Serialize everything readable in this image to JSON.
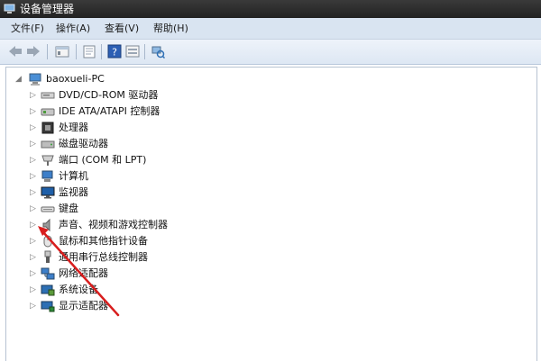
{
  "window": {
    "title": "设备管理器"
  },
  "menubar": {
    "items": [
      {
        "label": "文件(F)"
      },
      {
        "label": "操作(A)"
      },
      {
        "label": "查看(V)"
      },
      {
        "label": "帮助(H)"
      }
    ]
  },
  "toolbar": {
    "buttons": [
      {
        "icon": "back-arrow-icon"
      },
      {
        "icon": "forward-arrow-icon"
      },
      {
        "icon": "console-tree-icon"
      },
      {
        "icon": "properties-icon"
      },
      {
        "icon": "help-icon"
      },
      {
        "icon": "view-icon"
      },
      {
        "icon": "scan-hardware-icon"
      }
    ]
  },
  "tree": {
    "root": {
      "label": "baoxueli-PC",
      "icon": "computer-icon",
      "expanded": true
    },
    "items": [
      {
        "label": "DVD/CD-ROM 驱动器",
        "icon": "dvd-drive-icon"
      },
      {
        "label": "IDE ATA/ATAPI 控制器",
        "icon": "ide-controller-icon"
      },
      {
        "label": "处理器",
        "icon": "processor-icon"
      },
      {
        "label": "磁盘驱动器",
        "icon": "disk-drive-icon"
      },
      {
        "label": "端口 (COM 和 LPT)",
        "icon": "port-icon"
      },
      {
        "label": "计算机",
        "icon": "computer-icon"
      },
      {
        "label": "监视器",
        "icon": "monitor-icon"
      },
      {
        "label": "键盘",
        "icon": "keyboard-icon"
      },
      {
        "label": "声音、视频和游戏控制器",
        "icon": "speaker-icon"
      },
      {
        "label": "鼠标和其他指针设备",
        "icon": "mouse-icon"
      },
      {
        "label": "通用串行总线控制器",
        "icon": "usb-icon"
      },
      {
        "label": "网络适配器",
        "icon": "network-adapter-icon"
      },
      {
        "label": "系统设备",
        "icon": "system-device-icon"
      },
      {
        "label": "显示适配器",
        "icon": "display-adapter-icon"
      }
    ]
  },
  "colors": {
    "titlebar": "#2b2b2b",
    "menubar": "#d9e4f1",
    "annotation_arrow": "#d81e1e"
  }
}
